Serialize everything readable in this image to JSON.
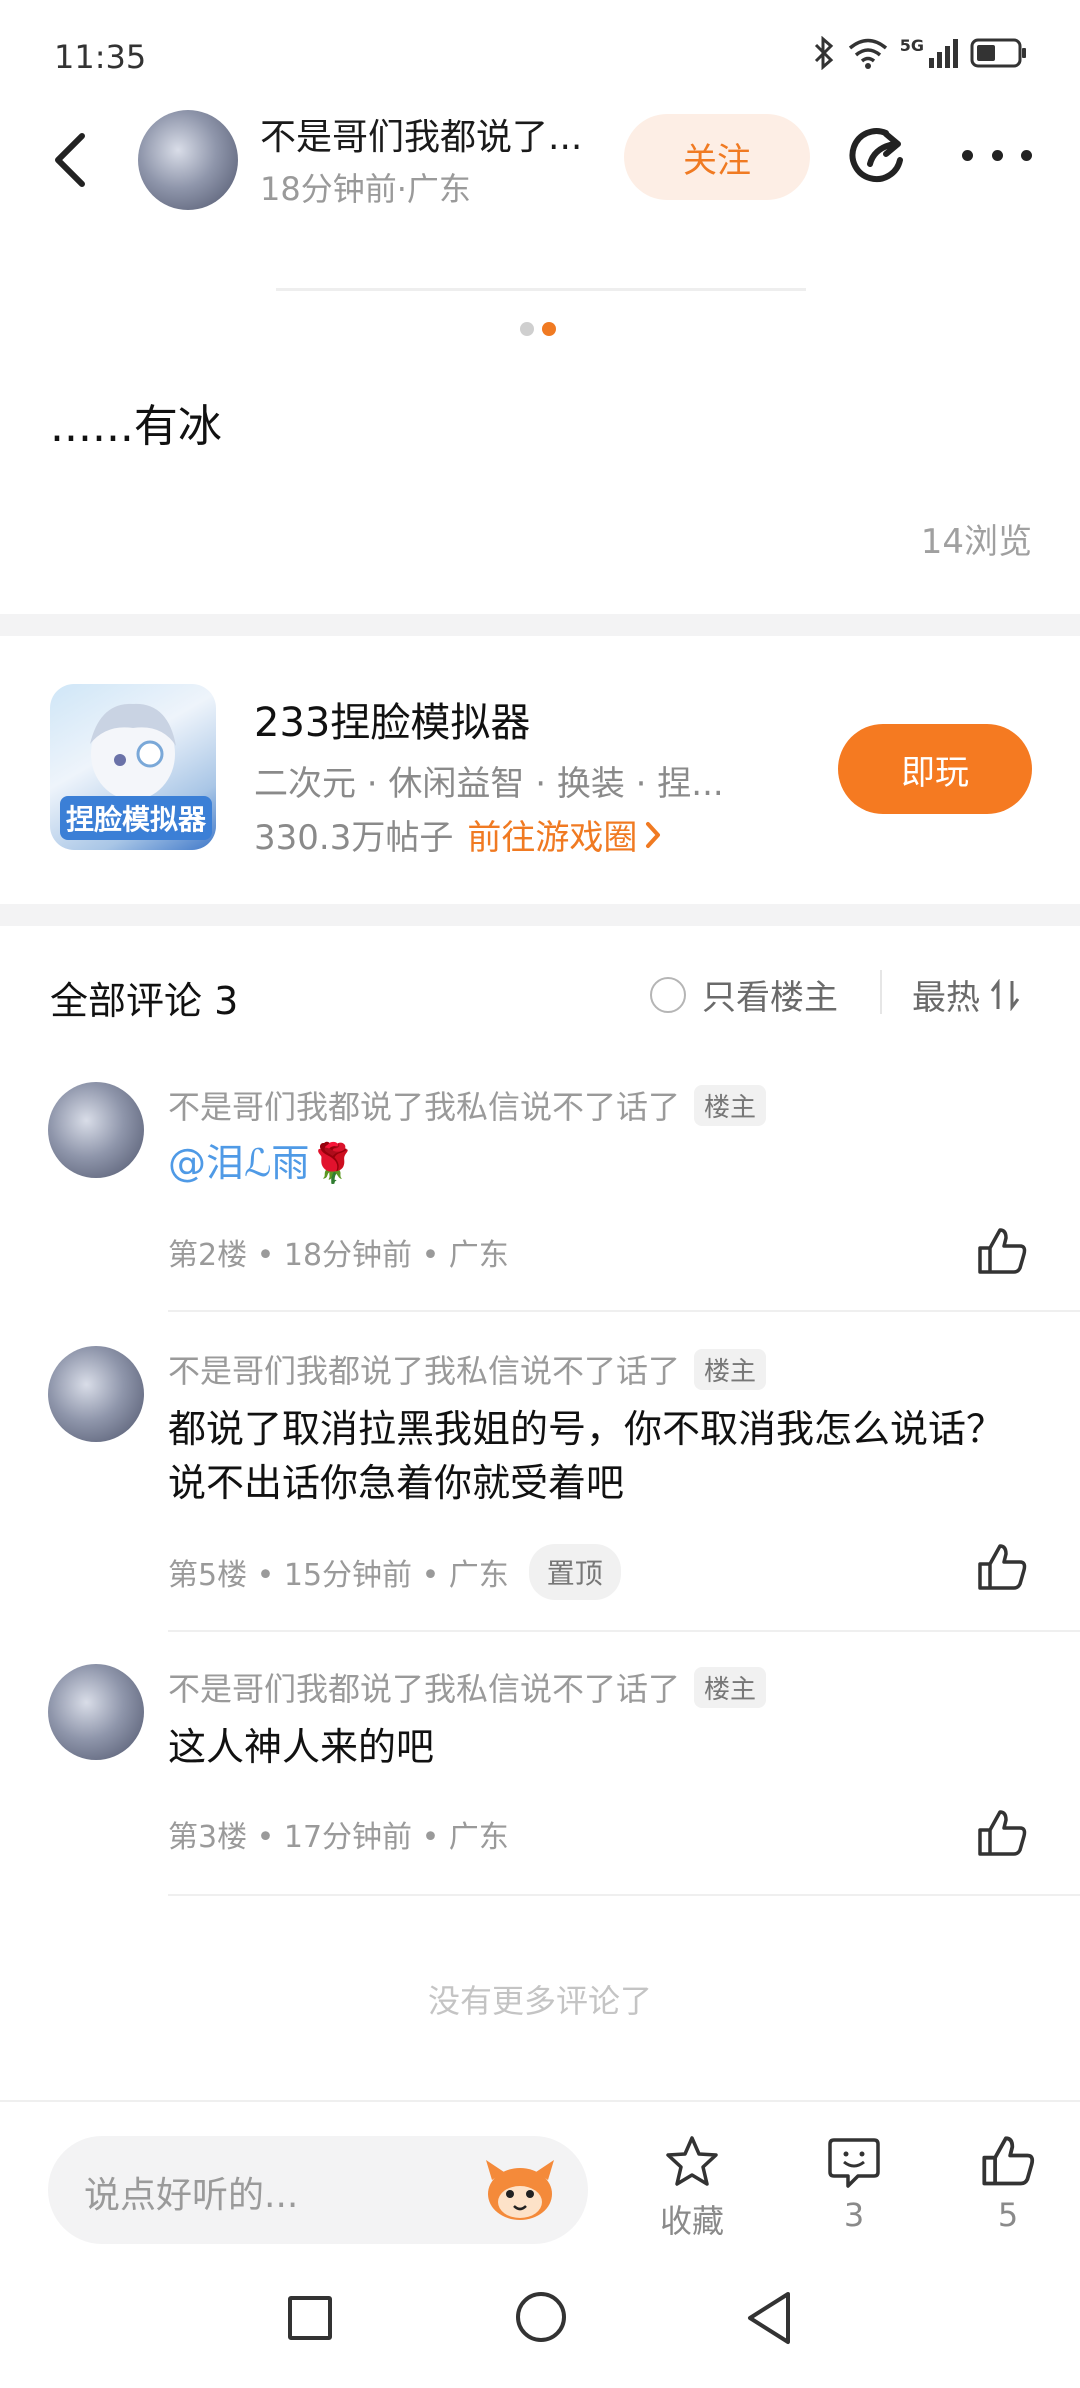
{
  "status_bar": {
    "time": "11:35",
    "network": "5G"
  },
  "header": {
    "author_name": "不是哥们我都说了...",
    "post_meta": "18分钟前·广东",
    "follow_label": "关注"
  },
  "post": {
    "body": "......有冰",
    "views": "14浏览"
  },
  "game": {
    "title": "233捏脸模拟器",
    "tags": "二次元 · 休闲益智 · 换装 · 捏...",
    "posts_count": "330.3万帖子",
    "link_label": "前往游戏圈",
    "play_label": "即玩",
    "logo_text": "捏脸模拟器"
  },
  "comments_header": {
    "title": "全部评论 3",
    "only_author": "只看楼主",
    "sort_label": "最热"
  },
  "comments": [
    {
      "author": "不是哥们我都说了我私信说不了话了",
      "badge": "楼主",
      "mention": "@泪ℒ雨",
      "text": "",
      "emoji": "🌹",
      "meta": "第2楼 • 18分钟前 • 广东"
    },
    {
      "author": "不是哥们我都说了我私信说不了话了",
      "badge": "楼主",
      "text": "都说了取消拉黑我姐的号，你不取消我怎么说话？说不出话你急着你就受着吧",
      "meta": "第5楼 • 15分钟前 • 广东",
      "pinned": "置顶"
    },
    {
      "author": "不是哥们我都说了我私信说不了话了",
      "badge": "楼主",
      "text": "这人神人来的吧",
      "meta": "第3楼 • 17分钟前 • 广东"
    }
  ],
  "no_more": "没有更多评论了",
  "bottom_bar": {
    "input_placeholder": "说点好听的...",
    "favorite_label": "收藏",
    "comment_count": "3",
    "like_count": "5"
  },
  "colors": {
    "accent": "#f57a21",
    "follow_bg": "#fdeee5",
    "mention": "#4f9ae6"
  }
}
